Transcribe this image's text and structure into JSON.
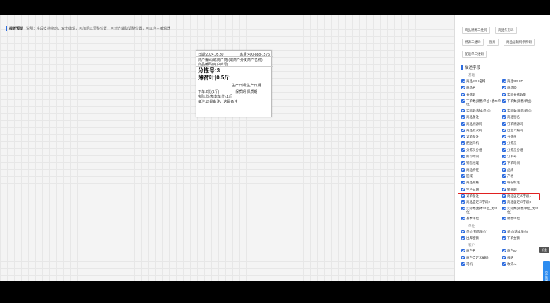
{
  "hint": {
    "title": "模板预览",
    "text": "说明：字段支持拖动，双击编辑，可加粗以调整位置，可对齐辅助调整位置，可以自主编辑器"
  },
  "label": {
    "line1_left": "日期:2024.05.30",
    "line1_right": "客服:400-888-1575",
    "line2": "商户编码(或商户简)(或商户分支商户名称)",
    "line3": "商品编码(商户商号)",
    "line4": "分拣号:3",
    "line5": "薄荷叶|0.5斤",
    "line6": "生产日期:生产日期",
    "line7_left": "下单:2份(1斤)",
    "line7_right": "保质期:保质期",
    "line8": "实际:份(基本单位):1斤",
    "line9": "备注:这是备注，这是备注"
  },
  "buttons": {
    "b1": "商品溯源二维码",
    "b2": "商品条形码",
    "b3": "溯源二维码",
    "b4": "图片",
    "b5": "商品运输码条形码",
    "b6": "配送单二维码"
  },
  "fields_title": "描述字段",
  "groups": {
    "base": "基础",
    "unit": "单位",
    "customer": "客户"
  },
  "fields": [
    [
      "商品SPU名称",
      "商品SPUID"
    ],
    [
      "商品名",
      "商品ID"
    ],
    [
      "分拣数",
      "实际分拣数量"
    ],
    [
      "下单数(销售单位+基本单位)",
      "下单数(销售单位)"
    ],
    [
      "实际数(基本单位)",
      "实际数(销售单位)"
    ],
    [
      "商品备注",
      "商品别名"
    ],
    [
      "商品溯源码",
      "订单溯源码"
    ],
    [
      "商品批次码",
      "自定义编码"
    ],
    [
      "订单备注",
      "分拣员"
    ],
    [
      "配送司机",
      "分拣员"
    ],
    [
      "分拣员分组",
      "分拣员分组"
    ],
    [
      "打印时间",
      "订单号"
    ],
    [
      "销售经理",
      "下单时间"
    ],
    [
      "商品特征",
      "品牌"
    ],
    [
      "区域",
      "产地"
    ],
    [
      "商品规格",
      "每份标准"
    ],
    [
      "生产日期",
      "保质期"
    ],
    [
      "订单备注",
      "商品自定义字段1"
    ],
    [
      "商品自定义字段2",
      "商品自定义字段3"
    ],
    [
      "实际数(基本单位_无单位)",
      "实际数(销售单位_无单位)"
    ],
    [
      "基本单位",
      "销售单位"
    ]
  ],
  "unit_fields": [
    [
      "单价(销售单位)",
      "单价(基本单位)"
    ],
    [
      "出库金额",
      "下单金额"
    ]
  ],
  "customer_fields": [
    [
      "商户名",
      "商户ID"
    ],
    [
      "商户自定义编码",
      "线路"
    ],
    [
      "司机",
      "收货人"
    ]
  ],
  "float_tab": "折叠",
  "float_side": "历史数据"
}
